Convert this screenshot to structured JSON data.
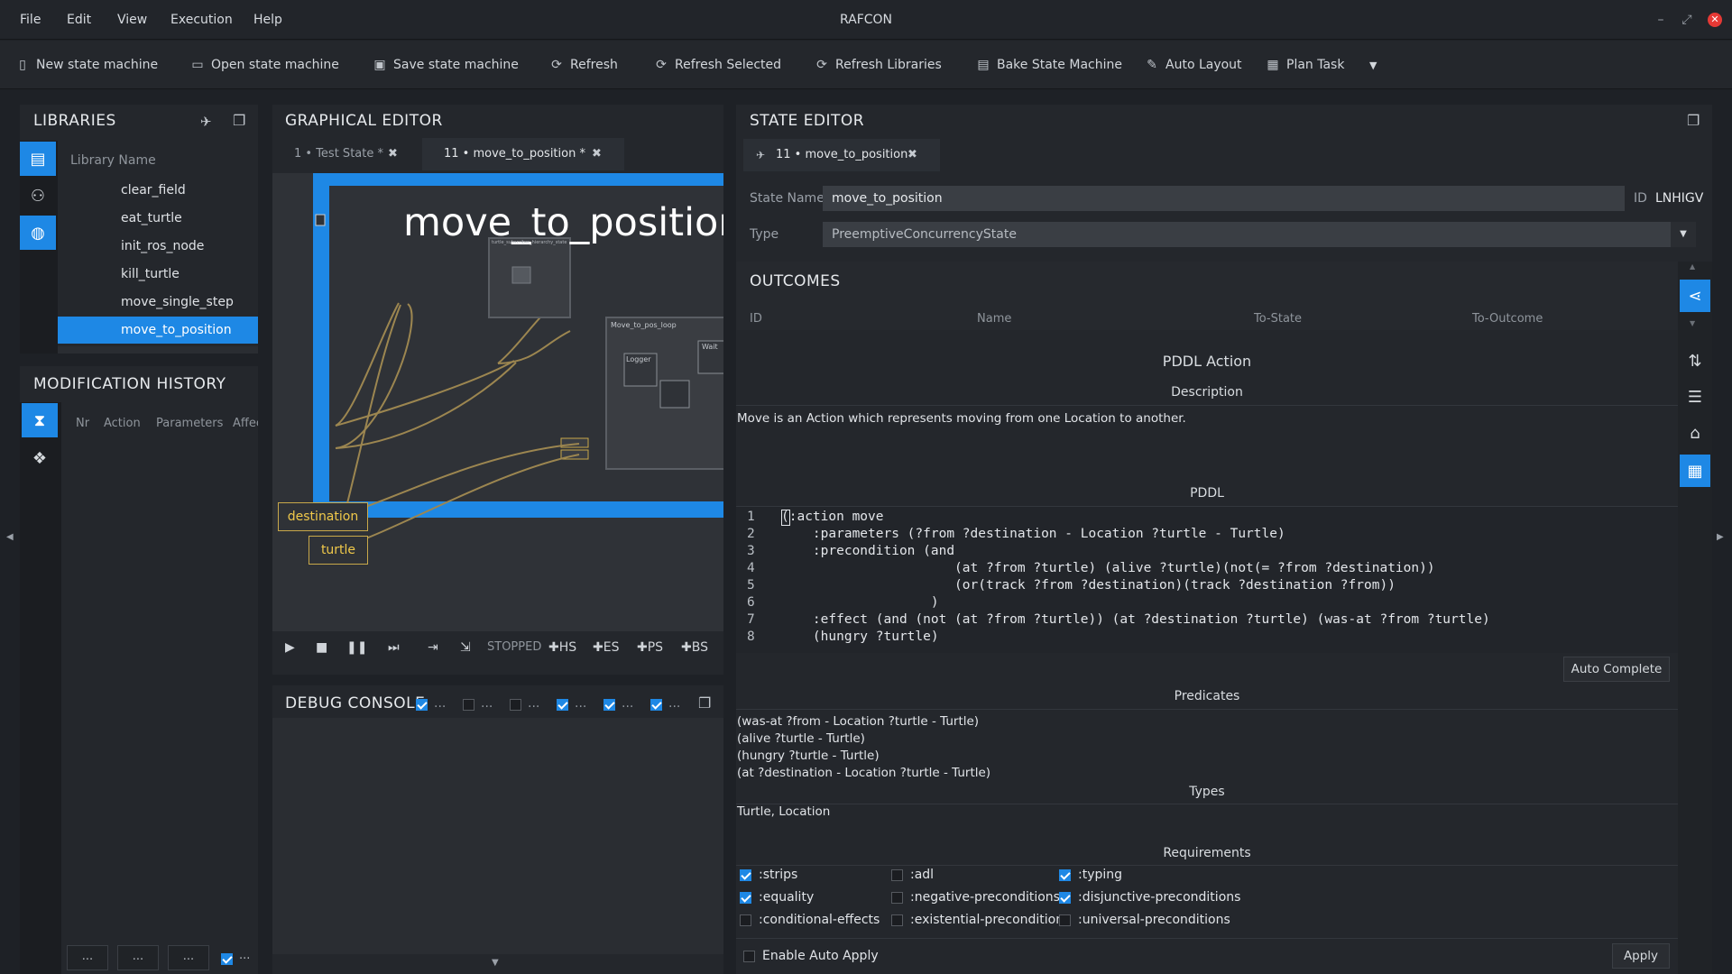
{
  "app": {
    "title": "RAFCON"
  },
  "menu": [
    "File",
    "Edit",
    "View",
    "Execution",
    "Help"
  ],
  "window_controls": {
    "minimize": "–",
    "restore": "⤢",
    "close": "✕"
  },
  "toolbar": {
    "new_state_machine": "New state machine",
    "open_state_machine": "Open state machine",
    "save_state_machine": "Save state machine",
    "refresh": "Refresh",
    "refresh_selected": "Refresh Selected",
    "refresh_libraries": "Refresh Libraries",
    "bake_state_machine": "Bake State Machine",
    "auto_layout": "Auto Layout",
    "plan_task": "Plan Task"
  },
  "libraries": {
    "title": "LIBRARIES",
    "column_header": "Library Name",
    "items": [
      "clear_field",
      "eat_turtle",
      "init_ros_node",
      "kill_turtle",
      "move_single_step",
      "move_to_position"
    ],
    "selected": "move_to_position"
  },
  "modification_history": {
    "title": "MODIFICATION HISTORY",
    "columns": [
      "Nr",
      "Action",
      "Parameters",
      "Affec"
    ],
    "buttons": [
      "...",
      "...",
      "...",
      "..."
    ]
  },
  "graphical_editor": {
    "title": "GRAPHICAL EDITOR",
    "tabs": [
      {
        "label": "1 • Test State *",
        "active": false
      },
      {
        "label": "11 • move_to_position *",
        "active": true
      }
    ],
    "state_name": "move_to_position",
    "inner_state_1": "turtle_subscriber_hierarchy_state",
    "inner_state_2": "Move_to_pos_loop",
    "inner_logger": "Logger",
    "inner_wait": "Wait",
    "ports": [
      "destination",
      "turtle"
    ],
    "execution": {
      "status": "STOPPED",
      "hs": "HS",
      "es": "ES",
      "ps": "PS",
      "bs": "BS"
    }
  },
  "debug_console": {
    "title": "DEBUG CONSOLE",
    "filters": [
      {
        "label": "...",
        "checked": true
      },
      {
        "label": "...",
        "checked": false
      },
      {
        "label": "...",
        "checked": false
      },
      {
        "label": "...",
        "checked": true
      },
      {
        "label": "...",
        "checked": true
      },
      {
        "label": "...",
        "checked": true
      }
    ]
  },
  "state_editor": {
    "title": "STATE EDITOR",
    "tab_label": "11 • move_to_position",
    "state_name_label": "State Name",
    "state_name_value": "move_to_position",
    "id_label": "ID",
    "id_value": "LNHIGV",
    "type_label": "Type",
    "type_value": "PreemptiveConcurrencyState",
    "outcomes": {
      "title": "OUTCOMES",
      "columns": [
        "ID",
        "Name",
        "To-State",
        "To-Outcome"
      ]
    },
    "pddl": {
      "title": "PDDL Action",
      "description_label": "Description",
      "description": "Move is an Action which represents  moving from one Location to another.",
      "pddl_label": "PDDL",
      "code_lines": [
        "(:action move",
        "    :parameters (?from ?destination - Location ?turtle - Turtle)",
        "    :precondition (and",
        "                      (at ?from ?turtle) (alive ?turtle)(not(= ?from ?destination))",
        "                      (or(track ?from ?destination)(track ?destination ?from))",
        "                   )",
        "    :effect (and (not (at ?from ?turtle)) (at ?destination ?turtle) (was-at ?from ?turtle)",
        "    (hungry ?turtle)"
      ],
      "auto_complete": "Auto Complete",
      "predicates_label": "Predicates",
      "predicates": [
        "(was-at ?from - Location ?turtle - Turtle)",
        "(alive ?turtle - Turtle)",
        "(hungry ?turtle - Turtle)",
        "(at ?destination - Location ?turtle - Turtle)"
      ],
      "types_label": "Types",
      "types": "Turtle, Location",
      "requirements_label": "Requirements",
      "requirements": [
        {
          "label": ":strips",
          "checked": true
        },
        {
          "label": ":adl",
          "checked": false
        },
        {
          "label": ":typing",
          "checked": true
        },
        {
          "label": ":equality",
          "checked": true
        },
        {
          "label": ":negative-preconditions",
          "checked": false
        },
        {
          "label": ":disjunctive-preconditions",
          "checked": true
        },
        {
          "label": ":conditional-effects",
          "checked": false
        },
        {
          "label": ":existential-preconditions",
          "checked": false
        },
        {
          "label": ":universal-preconditions",
          "checked": false
        }
      ],
      "enable_auto_apply": "Enable Auto Apply",
      "apply": "Apply"
    }
  },
  "colors": {
    "accent": "#1e88e5",
    "port": "#f0c94a",
    "background": "#1e2126"
  }
}
